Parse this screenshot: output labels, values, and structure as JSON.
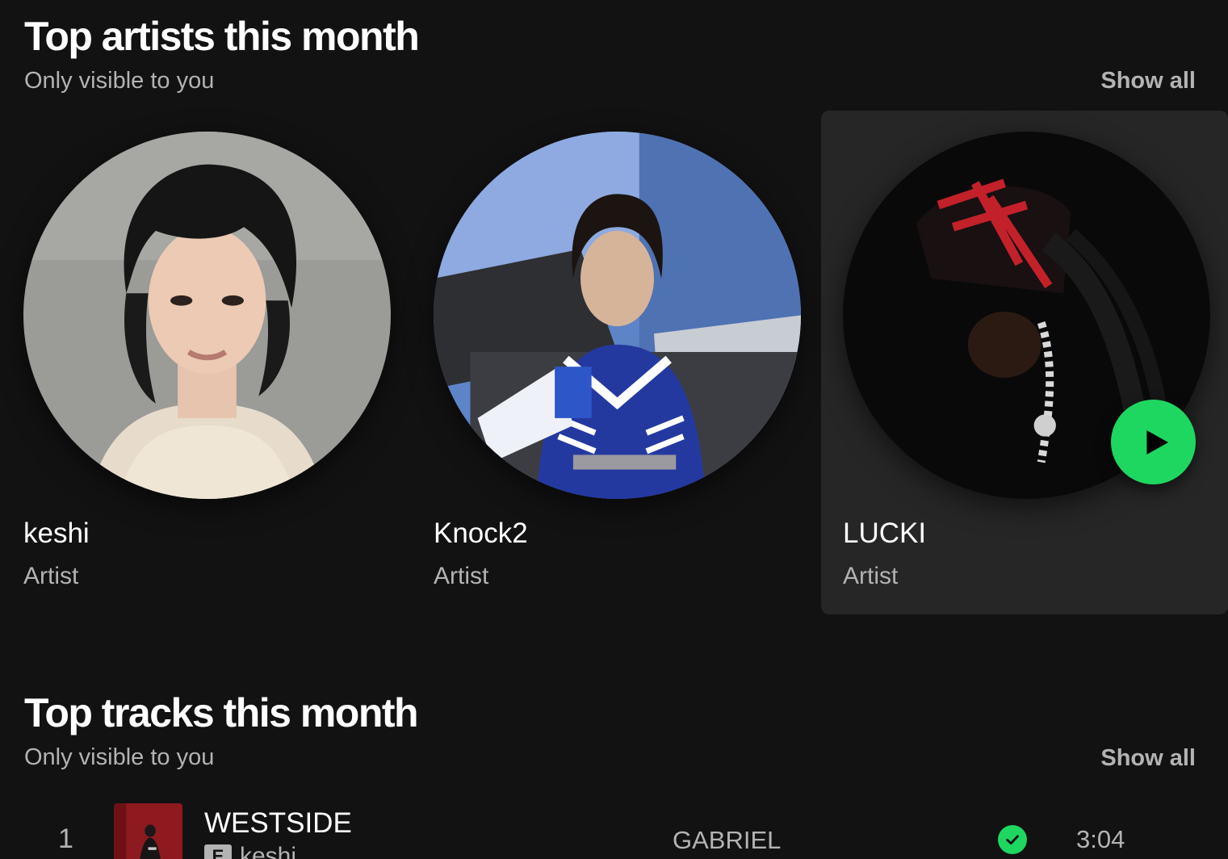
{
  "top_artists": {
    "title": "Top artists this month",
    "subtitle": "Only visible to you",
    "show_all_label": "Show all",
    "artists": [
      {
        "name": "keshi",
        "type": "Artist",
        "image": "keshi-portrait"
      },
      {
        "name": "Knock2",
        "type": "Artist",
        "image": "knock2-portrait"
      },
      {
        "name": "LUCKI",
        "type": "Artist",
        "image": "lucki-portrait",
        "hovered": true,
        "action_icon": "play-icon"
      }
    ]
  },
  "top_tracks": {
    "title": "Top tracks this month",
    "subtitle": "Only visible to you",
    "show_all_label": "Show all",
    "tracks": [
      {
        "index": "1",
        "title": "WESTSIDE",
        "explicit_label": "E",
        "artist": "keshi",
        "album": "GABRIEL",
        "saved": true,
        "saved_icon": "check-circle-icon",
        "duration": "3:04"
      }
    ]
  },
  "colors": {
    "background": "#121212",
    "card_hover": "#262626",
    "accent_green": "#1ed760",
    "muted_text": "#b3b3b3"
  }
}
